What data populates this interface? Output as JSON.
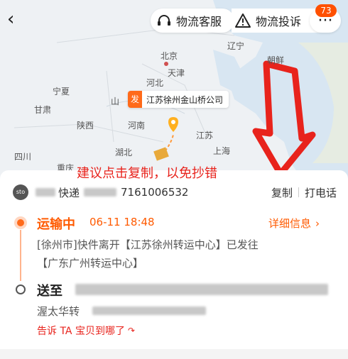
{
  "topbar": {
    "back_icon": "chevron-left-icon",
    "service_label": "物流客服",
    "complaint_label": "物流投诉",
    "more_badge": "73"
  },
  "map": {
    "places": {
      "beijing": "北京",
      "tianjin": "天津",
      "liaoning": "辽宁",
      "korea": "朝鲜",
      "hebei": "河北",
      "ningxia": "宁夏",
      "shanxi": "山",
      "gansu": "甘肃",
      "shaanxi": "陕西",
      "henan": "河南",
      "jiangsu": "江苏",
      "shanghai": "上海",
      "hubei": "湖北",
      "sichuan": "四川",
      "chongqing": "重庆"
    },
    "origin_tag_prefix": "发",
    "origin_tag_label": "江苏徐州金山桥公司",
    "annotation": "建议点击复制，以免抄错"
  },
  "shipment": {
    "courier_logo": "sto",
    "courier_name": "快递",
    "tracking_number": "7161006532",
    "copy_label": "复制",
    "call_label": "打电话"
  },
  "status": {
    "title": "运输中",
    "time": "06-11 18:48",
    "details_label": "详细信息",
    "line1": "[徐州市]快件离开【江苏徐州转运中心】已发往",
    "line2": "【广东广州转运中心】"
  },
  "delivery": {
    "send_to": "送至",
    "address_prefix": "渥太华转",
    "tell_label": "告诉 TA 宝贝到哪了"
  },
  "colors": {
    "accent": "#ff6a1a",
    "annotation_red": "#e8231c"
  }
}
